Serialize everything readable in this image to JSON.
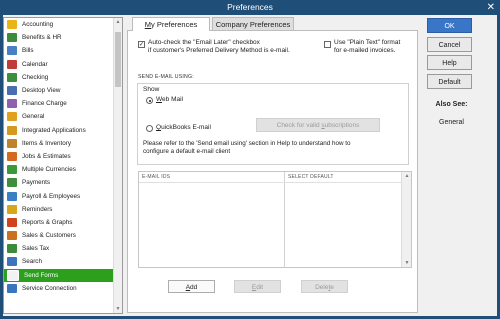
{
  "window": {
    "title": "Preferences",
    "close_glyph": "✕"
  },
  "sidebar": {
    "items": [
      {
        "label": "Accounting",
        "icon": "accounting-icon",
        "color": "#e8b417",
        "selected": false
      },
      {
        "label": "Benefits & HR",
        "icon": "benefits-hr-icon",
        "color": "#3b8c3b",
        "selected": false
      },
      {
        "label": "Bills",
        "icon": "bills-icon",
        "color": "#4a7fc1",
        "selected": false
      },
      {
        "label": "Calendar",
        "icon": "calendar-icon",
        "color": "#c23b3b",
        "selected": false
      },
      {
        "label": "Checking",
        "icon": "checking-icon",
        "color": "#3e8e3e",
        "selected": false
      },
      {
        "label": "Desktop View",
        "icon": "desktop-view-icon",
        "color": "#4a6fb0",
        "selected": false
      },
      {
        "label": "Finance Charge",
        "icon": "finance-charge-icon",
        "color": "#8f5fb0",
        "selected": false
      },
      {
        "label": "General",
        "icon": "general-icon",
        "color": "#e0a020",
        "selected": false
      },
      {
        "label": "Integrated Applications",
        "icon": "integrated-apps-icon",
        "color": "#d39a1f",
        "selected": false
      },
      {
        "label": "Items & Inventory",
        "icon": "items-inventory-icon",
        "color": "#c0822a",
        "selected": false
      },
      {
        "label": "Jobs & Estimates",
        "icon": "jobs-estimates-icon",
        "color": "#d46a1e",
        "selected": false
      },
      {
        "label": "Multiple Currencies",
        "icon": "multiple-currencies-icon",
        "color": "#3a9a3a",
        "selected": false
      },
      {
        "label": "Payments",
        "icon": "payments-icon",
        "color": "#3d8f3d",
        "selected": false
      },
      {
        "label": "Payroll & Employees",
        "icon": "payroll-employees-icon",
        "color": "#3a7fc4",
        "selected": false
      },
      {
        "label": "Reminders",
        "icon": "reminders-icon",
        "color": "#d6a719",
        "selected": false
      },
      {
        "label": "Reports & Graphs",
        "icon": "reports-graphs-icon",
        "color": "#d0431e",
        "selected": false
      },
      {
        "label": "Sales & Customers",
        "icon": "sales-customers-icon",
        "color": "#c9711c",
        "selected": false
      },
      {
        "label": "Sales Tax",
        "icon": "sales-tax-icon",
        "color": "#3b8b3b",
        "selected": false
      },
      {
        "label": "Search",
        "icon": "search-icon",
        "color": "#3e74bd",
        "selected": false
      },
      {
        "label": "Send Forms",
        "icon": "send-forms-icon",
        "color": "#f2f2f2",
        "selected": true
      },
      {
        "label": "Service Connection",
        "icon": "service-connection-icon",
        "color": "#3a76c0",
        "selected": false
      }
    ]
  },
  "tabs": {
    "my_prefix": "",
    "my_underlined": "M",
    "my_rest": "y Preferences",
    "company": "Company Preferences"
  },
  "options": {
    "auto_check": {
      "line1": "Auto-check the \"Email Later\" checkbox",
      "line2": "if customer's Preferred Delivery Method is e-mail.",
      "checked": true
    },
    "plain_text": {
      "line1": "Use \"Plain Text\" format",
      "line2": "for e-mailed invoices.",
      "checked": false
    }
  },
  "send_email": {
    "section_label": "SEND E-MAIL USING:",
    "show_label": "Show",
    "web_mail": {
      "prefix": "",
      "underlined": "W",
      "rest": "eb Mail",
      "selected": true
    },
    "quickbooks_email": {
      "prefix": "",
      "underlined": "Q",
      "rest": "uickBooks E-mail",
      "selected": false
    },
    "check_button": {
      "prefix": "Check for valid ",
      "underlined": "s",
      "rest": "ubscriptions"
    },
    "help_line1": "Please refer to the 'Send email using' section in Help to understand how to",
    "help_line2": "configure a default e-mail client"
  },
  "table": {
    "col1": "E-MAIL IDS",
    "col2": "SELECT DEFAULT"
  },
  "table_buttons": {
    "add": {
      "underlined": "A",
      "rest": "dd"
    },
    "edit": {
      "underlined": "E",
      "rest": "dit"
    },
    "delete": {
      "prefix": "Dele",
      "underlined": "t",
      "rest": "e"
    }
  },
  "right_buttons": {
    "ok": "OK",
    "cancel": "Cancel",
    "help": "Help",
    "default": "Default"
  },
  "also_see": {
    "title": "Also See:",
    "general": "General"
  },
  "colors": {
    "title_bar": "#1f4e79",
    "selected": "#2ca01c",
    "ok_button": "#3a76c8"
  }
}
